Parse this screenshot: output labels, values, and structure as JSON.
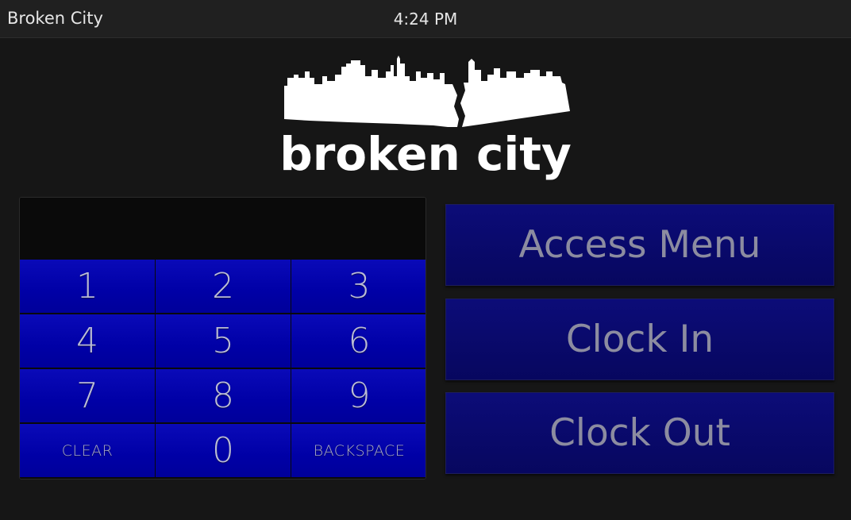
{
  "titlebar": {
    "app_title": "Broken City",
    "time": "4:24 PM"
  },
  "logo": {
    "text": "broken city"
  },
  "keypad": {
    "display_value": "",
    "keys": [
      "1",
      "2",
      "3",
      "4",
      "5",
      "6",
      "7",
      "8",
      "9",
      "CLEAR",
      "0",
      "BACKSPACE"
    ]
  },
  "actions": {
    "access_menu": "Access Menu",
    "clock_in": "Clock In",
    "clock_out": "Clock Out"
  },
  "colors": {
    "key_blue": "#0000a6",
    "action_navy": "#07075f",
    "background": "#161616"
  }
}
